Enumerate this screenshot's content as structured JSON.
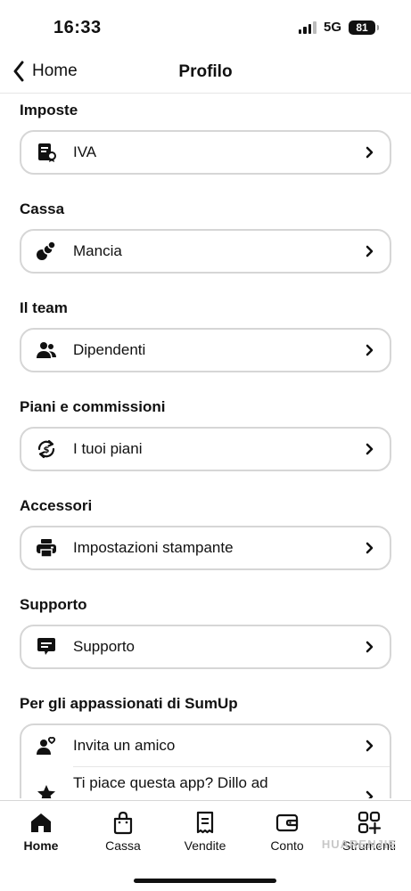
{
  "status": {
    "time": "16:33",
    "network": "5G",
    "battery": "81"
  },
  "nav": {
    "back_label": "Home",
    "title": "Profilo"
  },
  "sections": [
    {
      "title": "Imposte",
      "items": [
        {
          "label": "IVA",
          "icon": "receipt-icon"
        }
      ]
    },
    {
      "title": "Cassa",
      "items": [
        {
          "label": "Mancia",
          "icon": "coins-icon"
        }
      ]
    },
    {
      "title": "Il team",
      "items": [
        {
          "label": "Dipendenti",
          "icon": "people-icon"
        }
      ]
    },
    {
      "title": "Piani e commissioni",
      "items": [
        {
          "label": "I tuoi piani",
          "icon": "dollar-cycle-icon"
        }
      ]
    },
    {
      "title": "Accessori",
      "items": [
        {
          "label": "Impostazioni stampante",
          "icon": "printer-icon"
        }
      ]
    },
    {
      "title": "Supporto",
      "items": [
        {
          "label": "Supporto",
          "icon": "chat-icon"
        }
      ]
    },
    {
      "title": "Per gli appassionati di SumUp",
      "items": [
        {
          "label": "Invita un amico",
          "icon": "invite-friend-icon"
        },
        {
          "label": "Ti piace questa app? Dillo ad",
          "icon": "star-icon"
        }
      ]
    }
  ],
  "tabs": [
    {
      "label": "Home",
      "icon": "home-icon",
      "active": true
    },
    {
      "label": "Cassa",
      "icon": "bag-icon",
      "active": false
    },
    {
      "label": "Vendite",
      "icon": "receipt-list-icon",
      "active": false
    },
    {
      "label": "Conto",
      "icon": "wallet-icon",
      "active": false
    },
    {
      "label": "Strumenti",
      "icon": "grid-plus-icon",
      "active": false
    }
  ],
  "watermark": "HUARENJIE"
}
